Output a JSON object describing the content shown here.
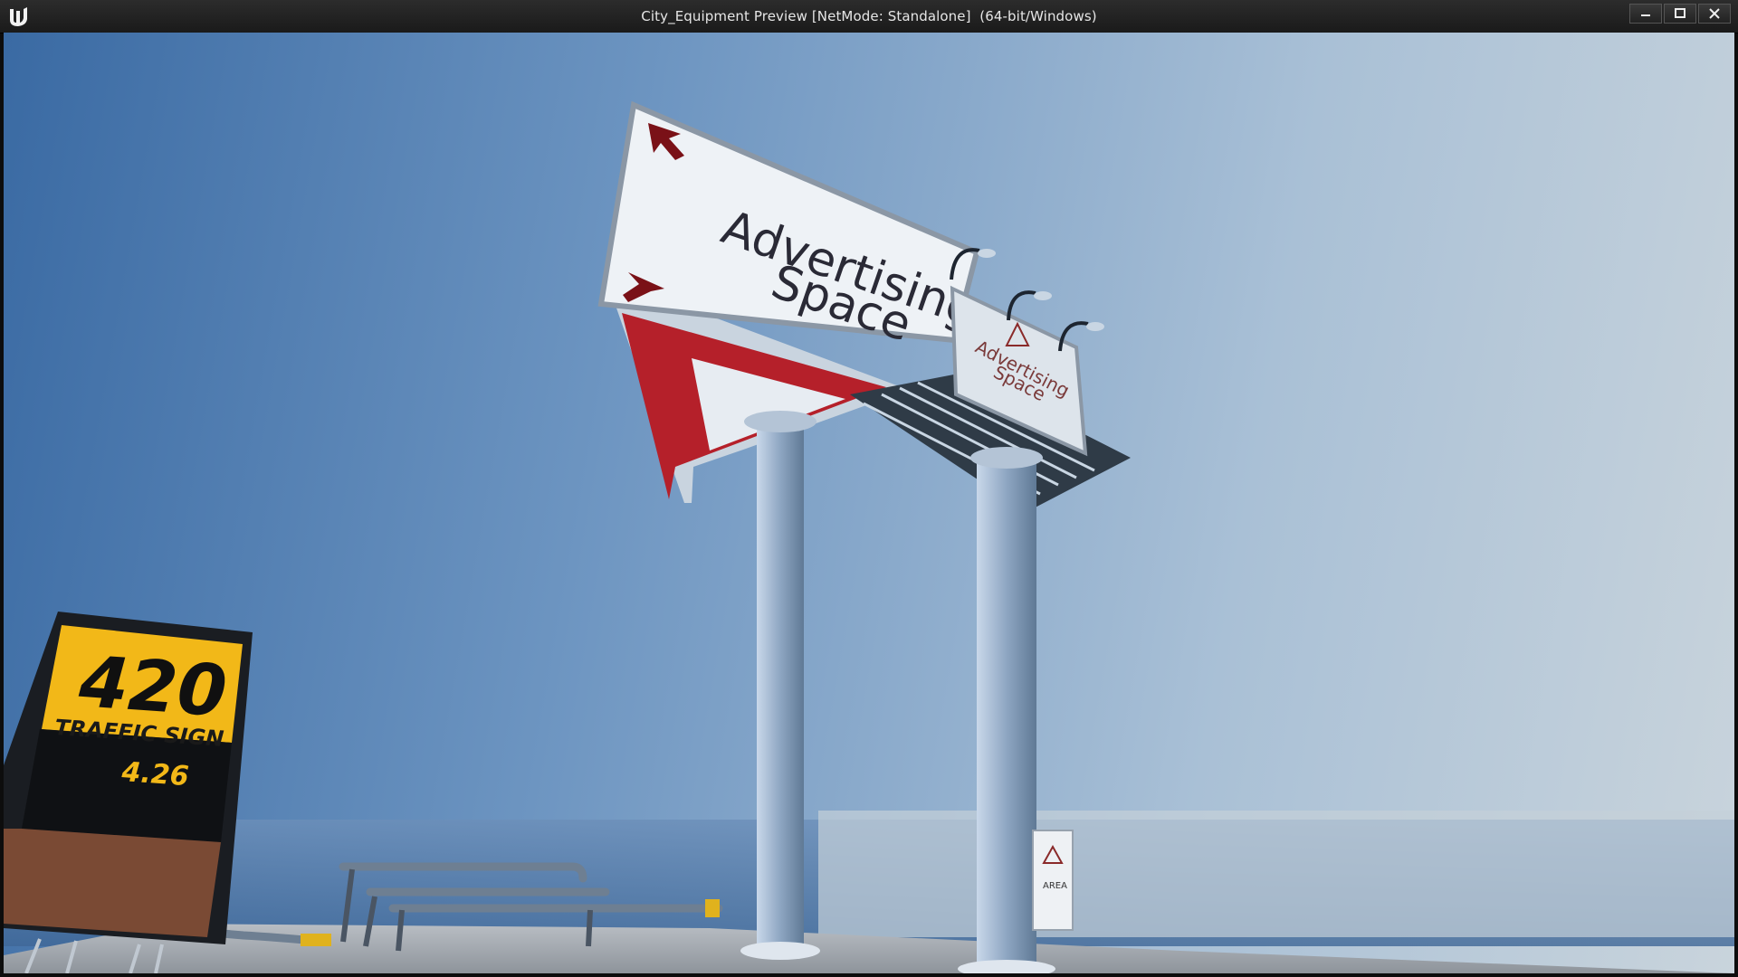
{
  "window": {
    "title": "City_Equipment Preview [NetMode: Standalone]  (64-bit/Windows)",
    "controls": {
      "minimize": "minimize",
      "maximize": "maximize",
      "close": "close"
    }
  },
  "scene": {
    "billboard_main_text_line1": "Advertising",
    "billboard_main_text_line2": "Space",
    "billboard_small_text_line1": "Advertising",
    "billboard_small_text_line2": "Space",
    "traffic_sign_number": "420",
    "traffic_sign_label": "TRAFFIC SIGN",
    "traffic_sign_version": "4.26",
    "pole_panel_text": "AREA"
  },
  "colors": {
    "sky_left": "#3a6aa3",
    "sky_right": "#c9d4dc",
    "billboard_red": "#b5202a",
    "sign_yellow": "#f2b818"
  },
  "icons": [
    "ue-logo-icon",
    "minimize-icon",
    "maximize-icon",
    "close-icon",
    "arrow-icon",
    "warning-icon"
  ]
}
